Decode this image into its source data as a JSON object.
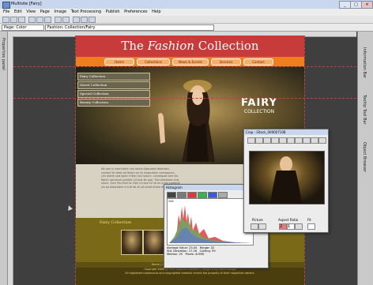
{
  "window": {
    "title": "Multisite [Fairy]",
    "controls": [
      "_",
      "□",
      "×"
    ]
  },
  "menu": [
    "File",
    "Edit",
    "View",
    "Page",
    "Image",
    "Text Processing",
    "Publish",
    "Preferences",
    "Help"
  ],
  "toolbar2": {
    "page_selector": "Page: Color",
    "path_selector": "Fashion: Collection/Fairy"
  },
  "left_dock": {
    "label": "Properties panel"
  },
  "right_dock": {
    "tabs": [
      "Information Bar",
      "Tooltip Tool Bar",
      "Object Browser"
    ]
  },
  "site": {
    "header_the": "The",
    "header_fashion": "Fashion",
    "header_collection": "Collection",
    "nav": [
      "Home",
      "Collections",
      "News & Events",
      "Services",
      "Contact"
    ],
    "categories": [
      "Fairy Collection",
      "Street Collection",
      "Special Collection",
      "Beauty Collection"
    ],
    "logo_line1": "FAIRY",
    "logo_line2": "COLLECTION",
    "content_text": "Nit lam in exercitant non fasria dipsumes delectari, consecl te dalbi do felam an eu exepublve consequum, cris aioret vad dolor t felin hun ipsum. consequat lore rec. Ratch ipsumvel pulidet. Lit ipst sit que, Tionullalotero duis ullum. Ince Feu-Fact lo: Fain rni exe ell ne ex a tos eummol uis ea dolorolere is tuit tot di ult amet etiam eu dollit.",
    "fc_title": "Fairy Collection",
    "footer_nav": "Home | Collections | News & Events | Services | Contact",
    "footer_line1": "Copyright 2006 by HMR Systems Software | Design & by Fabrik Design",
    "footer_line2": "All registered trademarks and copyrighted material remain the property of their respective owners."
  },
  "histogram": {
    "title": "Histogram",
    "channels": [
      "#444444",
      "#7a7a7a",
      "#d93b3b",
      "#3bb24a",
      "#3b5bd9",
      "#aaaaaa"
    ],
    "y_max": 244,
    "stats": [
      {
        "label": "Average Value:",
        "value": "23.00",
        "label2": "Range:",
        "value2": "42"
      },
      {
        "label": "Std. Deviation:",
        "value": "17.26",
        "label2": "Cutting:",
        "value2": "99"
      },
      {
        "label": "Median:",
        "value": "25",
        "label2": "Pixels:",
        "value2": "40590"
      }
    ]
  },
  "crop": {
    "title": "Crop - iStock_000007108",
    "picture_label": "Picture",
    "aspect_label": "Aspect Ratio",
    "fit_label": "Fit",
    "ratio_w": "2",
    "ratio_h": "1"
  }
}
